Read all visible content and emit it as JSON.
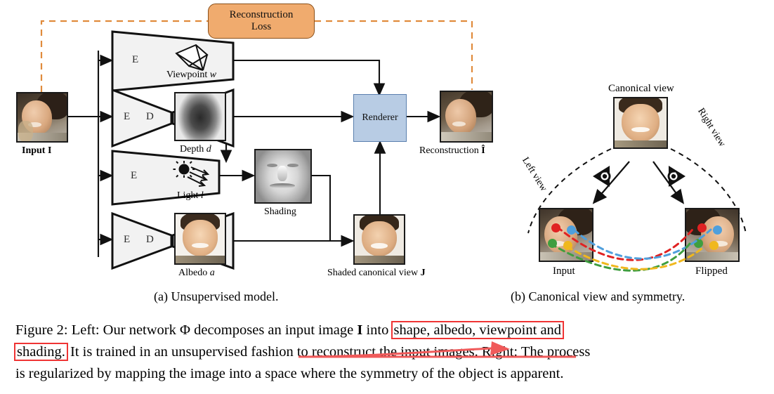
{
  "figure": {
    "panel_a": {
      "subcaption": "(a) Unsupervised model.",
      "loss_box": {
        "line1": "Reconstruction",
        "line2": "Loss",
        "fill": "#f0ab6e",
        "stroke": "#8a4f18"
      },
      "input_label": "Input I",
      "encoders": [
        {
          "id": "enc-viewpoint",
          "labels": [
            "E"
          ],
          "type": "encoder"
        },
        {
          "id": "enc-dec-depth",
          "labels": [
            "E",
            "D"
          ],
          "type": "encoder-decoder"
        },
        {
          "id": "enc-light",
          "labels": [
            "E"
          ],
          "type": "encoder"
        },
        {
          "id": "enc-dec-albedo",
          "labels": [
            "E",
            "D"
          ],
          "type": "encoder-decoder"
        }
      ],
      "viewpoint_label": "Viewpoint w",
      "depth_label": "Depth d",
      "light_label": "Light l",
      "shading_label": "Shading",
      "albedo_label": "Albedo a",
      "shaded_canonical_label": "Shaded canonical view J",
      "renderer_label": "Renderer",
      "renderer_fill": "#b8cce4",
      "reconstruction_label": "Reconstruction Î",
      "dashed_loss_color": "#e08b3c"
    },
    "panel_b": {
      "subcaption": "(b) Canonical view and symmetry.",
      "canonical_label": "Canonical view",
      "left_view_label": "Left view",
      "right_view_label": "Right view",
      "input_label": "Input",
      "flipped_label": "Flipped",
      "eye_icons": [
        "eye-icon-left",
        "eye-icon-right"
      ],
      "correspondence_colors": [
        "#e02222",
        "#4f9fdc",
        "#3f9e3f",
        "#f0b81e"
      ]
    }
  },
  "caption": {
    "lines": [
      [
        {
          "text": "Figure 2:  Left:  Our network Φ decomposes an input image ",
          "style": "plain"
        },
        {
          "text": "I",
          "style": "bold"
        },
        {
          "text": " into ",
          "style": "plain"
        },
        {
          "text": "shape, albedo, viewpoint and",
          "style": "boxed"
        }
      ],
      [
        {
          "text": "shading.",
          "style": "boxed"
        },
        {
          "text": " It is trained in an unsupervised fashion to reconstruct the input images. Right: The process",
          "style": "plain"
        }
      ],
      [
        {
          "text": "is regularized by mapping the image into a space where the symmetry of the object is apparent.",
          "style": "plain"
        }
      ]
    ],
    "annotation_color": "#ef3434",
    "arrow_color": "#f05a5a"
  }
}
